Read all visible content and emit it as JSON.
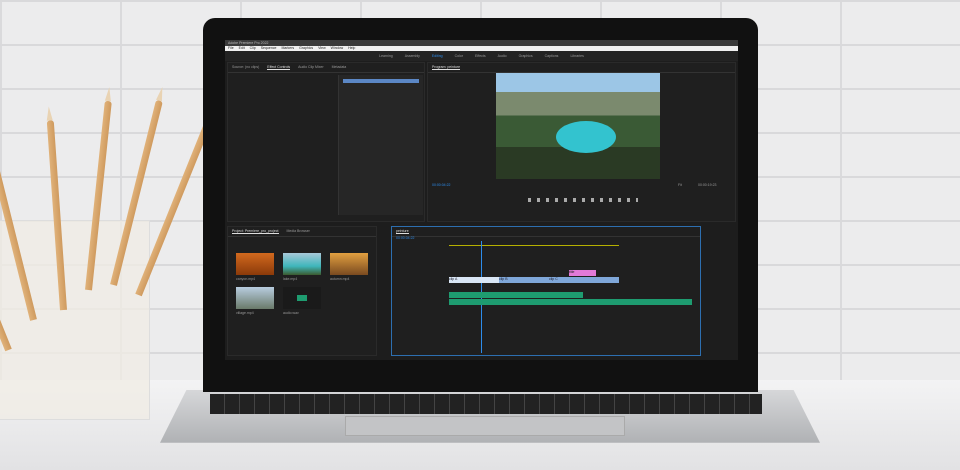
{
  "app": {
    "title": "Adobe Premiere Pro 2022"
  },
  "menu": [
    "File",
    "Edit",
    "Clip",
    "Sequence",
    "Markers",
    "Graphics",
    "View",
    "Window",
    "Help"
  ],
  "workspaces": [
    "Learning",
    "Assembly",
    "Editing",
    "Color",
    "Effects",
    "Audio",
    "Graphics",
    "Captions",
    "Libraries"
  ],
  "active_workspace": "Editing",
  "source_tabs": [
    "Source: (no clips)",
    "Effect Controls",
    "Audio Clip Mixer",
    "Metadata",
    "Program"
  ],
  "program": {
    "tab": "Program: peinture",
    "timecode_left": "00:00:04:22",
    "zoom": "Fit",
    "timecode_right": "00:00:19:23"
  },
  "project": {
    "tabs": [
      "Project: Premiere_pro_project",
      "Media Browser"
    ],
    "items": [
      {
        "name": "canyon.mp4"
      },
      {
        "name": "lake.mp4"
      },
      {
        "name": "autumn.mp4"
      },
      {
        "name": "village.mp4"
      },
      {
        "name": "audio.wav"
      }
    ]
  },
  "timeline": {
    "tab": "peinture",
    "timecode": "00:00:04:22",
    "clips": [
      "clip A",
      "clip B",
      "clip C",
      "title"
    ]
  },
  "colors": {
    "accent": "#2d8ceb",
    "video_clip": "#7fa7d9",
    "audio_clip": "#1e9c70",
    "title_clip": "#e27ad8"
  }
}
